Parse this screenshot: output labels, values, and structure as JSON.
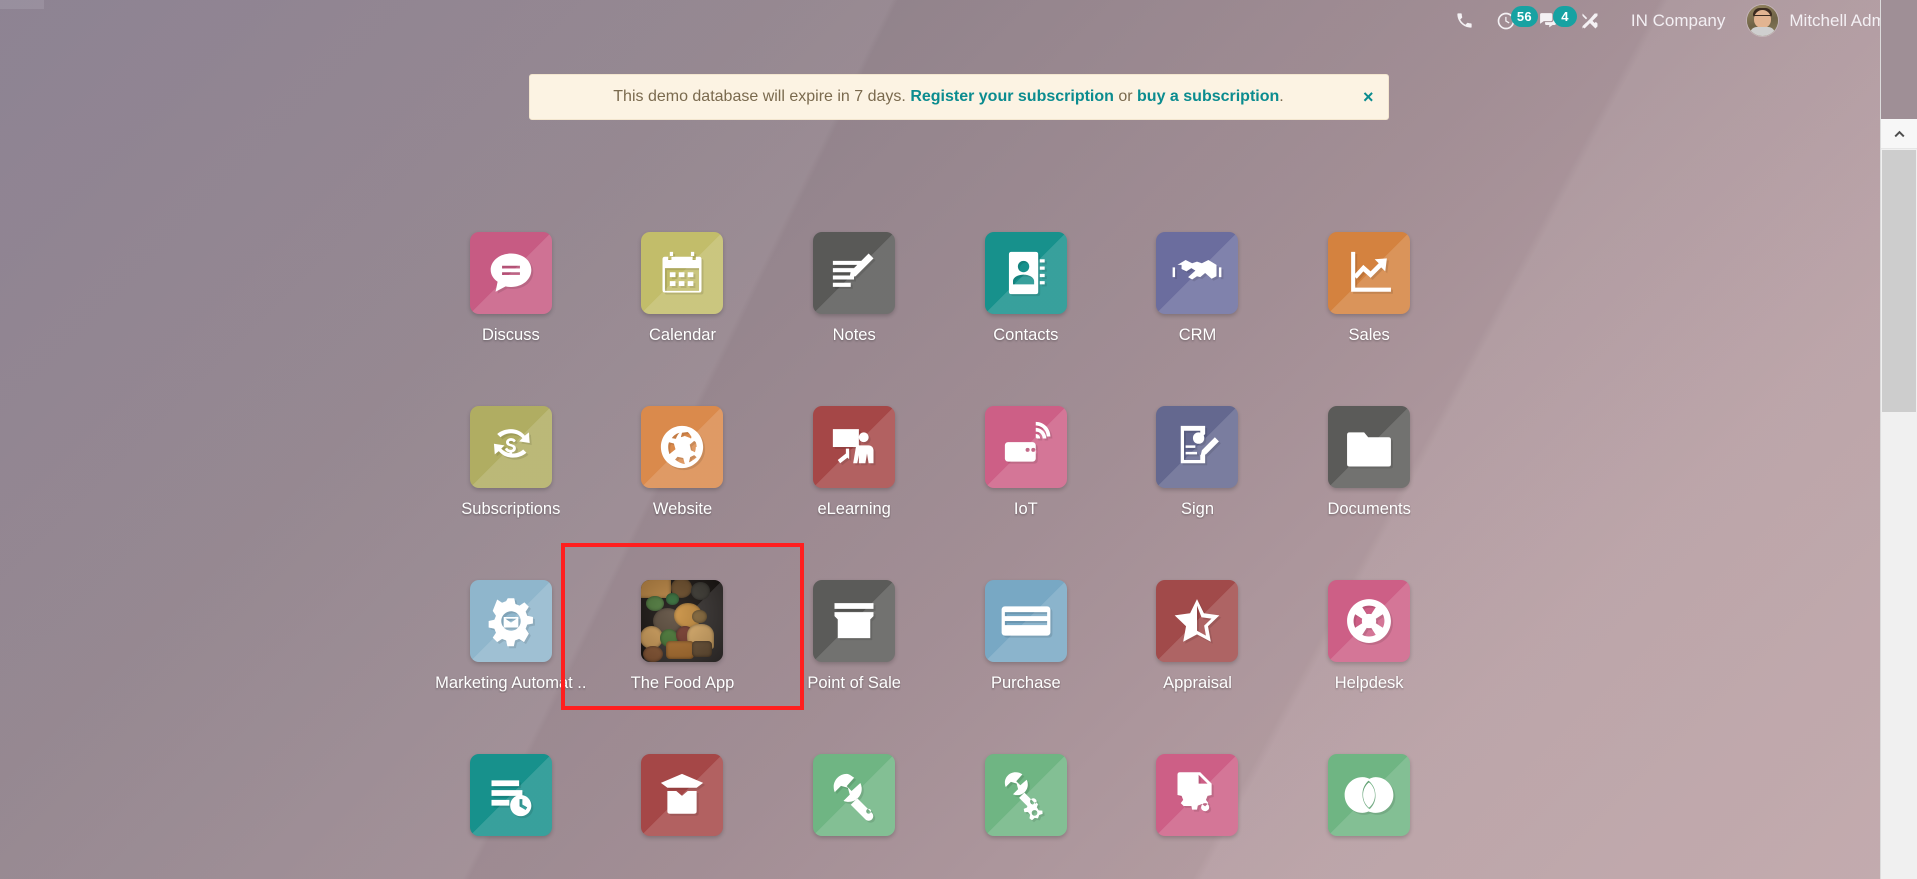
{
  "topbar": {
    "icons": [
      {
        "name": "phone-icon",
        "glyph": "phone",
        "badge": null
      },
      {
        "name": "activity-clock-icon",
        "glyph": "clock",
        "badge": "56"
      },
      {
        "name": "messages-icon",
        "glyph": "chat",
        "badge": "4"
      },
      {
        "name": "tools-icon",
        "glyph": "tools",
        "badge": null
      }
    ],
    "company": "IN Company",
    "user": "Mitchell Admin"
  },
  "banner": {
    "prefix": "This demo database will expire in 7 days. ",
    "link1": "Register your subscription",
    "middle": " or ",
    "link2": "buy a subscription",
    "suffix": ".",
    "close_label": "×",
    "bg_color": "#fcf3e3",
    "link_color": "#0b8c8f",
    "text_color": "#7a6a4e"
  },
  "apps": [
    {
      "label": "Discuss",
      "icon": "discuss-icon",
      "color": "#c75b83"
    },
    {
      "label": "Calendar",
      "icon": "calendar-icon",
      "color": "#c2bd6a"
    },
    {
      "label": "Notes",
      "icon": "notes-icon",
      "color": "#595957"
    },
    {
      "label": "Contacts",
      "icon": "contacts-icon",
      "color": "#17918c"
    },
    {
      "label": "CRM",
      "icon": "crm-handshake-icon",
      "color": "#6b6d9e"
    },
    {
      "label": "Sales",
      "icon": "sales-chart-icon",
      "color": "#d4823f"
    },
    {
      "label": "Subscriptions",
      "icon": "subscriptions-icon",
      "color": "#b0ad62"
    },
    {
      "label": "Website",
      "icon": "website-globe-icon",
      "color": "#da8a4c"
    },
    {
      "label": "eLearning",
      "icon": "elearning-icon",
      "color": "#a54747"
    },
    {
      "label": "IoT",
      "icon": "iot-icon",
      "color": "#cd5f86"
    },
    {
      "label": "Sign",
      "icon": "sign-icon",
      "color": "#64688f"
    },
    {
      "label": "Documents",
      "icon": "documents-icon",
      "color": "#5b5b59"
    },
    {
      "label": "Marketing Automat ..",
      "icon": "marketing-automation-icon",
      "color": "#8fb6cc"
    },
    {
      "label": "The Food App",
      "icon": "food-photo-icon",
      "color": "#17120f",
      "photo": true
    },
    {
      "label": "Point of Sale",
      "icon": "point-of-sale-icon",
      "color": "#5b5b59"
    },
    {
      "label": "Purchase",
      "icon": "purchase-card-icon",
      "color": "#78a8c4"
    },
    {
      "label": "Appraisal",
      "icon": "appraisal-star-icon",
      "color": "#a14a4a"
    },
    {
      "label": "Helpdesk",
      "icon": "helpdesk-lifebuoy-icon",
      "color": "#cd5f86"
    },
    {
      "label": "",
      "icon": "timesheets-icon",
      "color": "#17918c"
    },
    {
      "label": "",
      "icon": "inventory-box-icon",
      "color": "#a54747"
    },
    {
      "label": "",
      "icon": "repairs-wrench-icon",
      "color": "#6fb583"
    },
    {
      "label": "",
      "icon": "maintenance-icon",
      "color": "#6fb583"
    },
    {
      "label": "",
      "icon": "studio-document-icon",
      "color": "#cd5f86"
    },
    {
      "label": "",
      "icon": "venn-circles-icon",
      "color": "#6fb583"
    }
  ],
  "highlight": {
    "target": "The Food App",
    "color": "#ff1f1f"
  },
  "scrollbar": {
    "position_label": "scroll-up"
  }
}
